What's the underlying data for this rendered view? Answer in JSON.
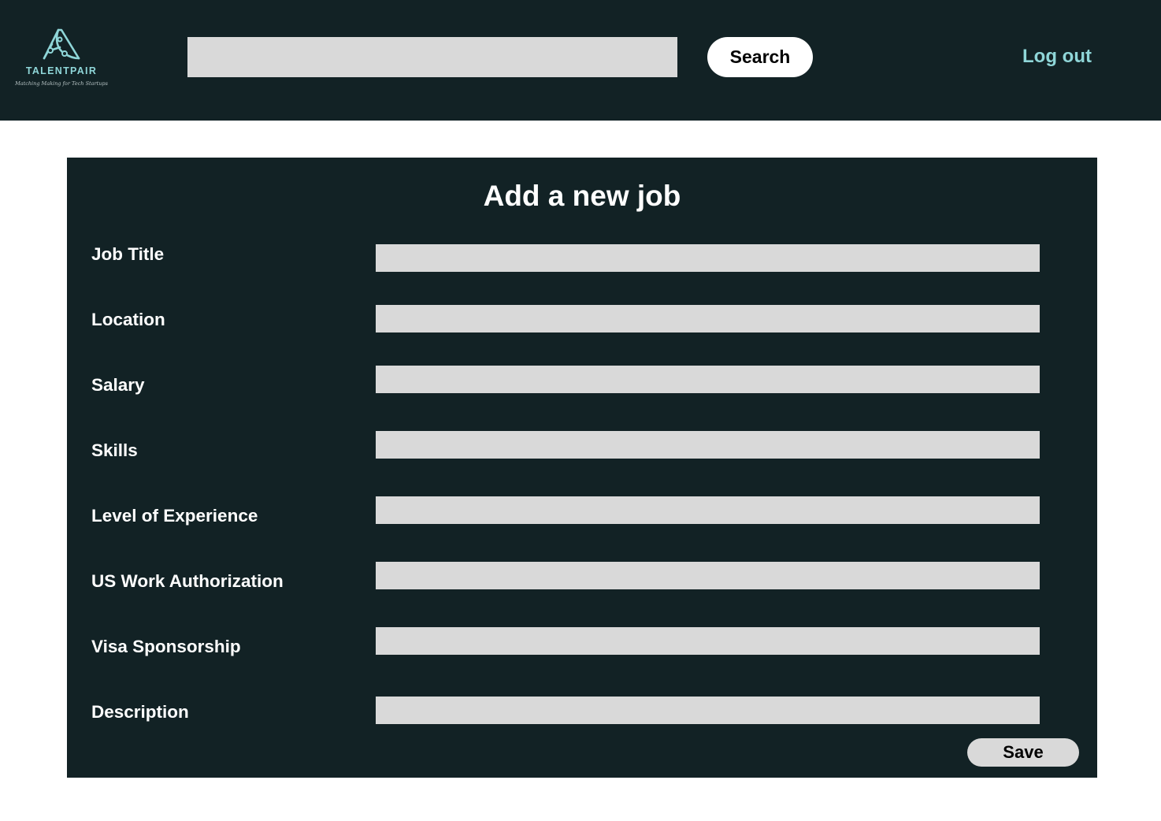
{
  "header": {
    "logo_name": "TALENTPAIR",
    "logo_tagline": "Matching Making for Tech Startups",
    "search_value": "",
    "search_button_label": "Search",
    "logout_label": "Log out"
  },
  "form": {
    "title": "Add a new job",
    "fields": [
      {
        "label": "Job Title",
        "value": ""
      },
      {
        "label": "Location",
        "value": ""
      },
      {
        "label": "Salary",
        "value": ""
      },
      {
        "label": "Skills",
        "value": ""
      },
      {
        "label": "Level of Experience",
        "value": ""
      },
      {
        "label": "US Work Authorization",
        "value": ""
      },
      {
        "label": "Visa Sponsorship",
        "value": ""
      },
      {
        "label": "Description",
        "value": ""
      }
    ],
    "save_label": "Save"
  },
  "colors": {
    "header_bg": "#122225",
    "panel_bg": "#122225",
    "accent": "#8fd6d8",
    "input_bg": "#d9d9d9",
    "page_bg": "#ffffff"
  },
  "icons": {
    "logo": "talentpair-logo-icon"
  }
}
